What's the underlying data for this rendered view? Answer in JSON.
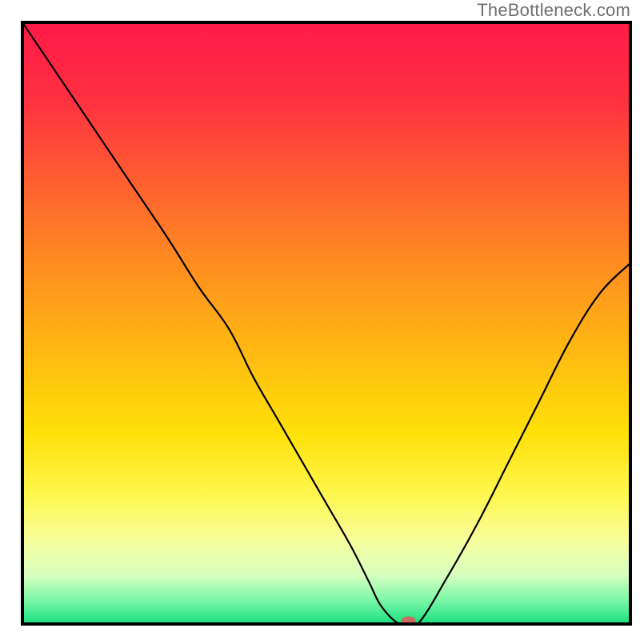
{
  "watermark": "TheBottleneck.com",
  "chart_data": {
    "type": "line",
    "title": "",
    "xlabel": "",
    "ylabel": "",
    "xlim": [
      0,
      100
    ],
    "ylim": [
      0,
      100
    ],
    "legend": false,
    "grid": false,
    "background_gradient": {
      "orientation": "vertical",
      "stops": [
        {
          "offset": 0.0,
          "color": "#ff1a49"
        },
        {
          "offset": 0.12,
          "color": "#ff2e42"
        },
        {
          "offset": 0.25,
          "color": "#ff5a32"
        },
        {
          "offset": 0.4,
          "color": "#ff8c20"
        },
        {
          "offset": 0.55,
          "color": "#ffba12"
        },
        {
          "offset": 0.68,
          "color": "#ffe008"
        },
        {
          "offset": 0.78,
          "color": "#fff64a"
        },
        {
          "offset": 0.86,
          "color": "#f8ff9c"
        },
        {
          "offset": 0.92,
          "color": "#d6ffc0"
        },
        {
          "offset": 0.96,
          "color": "#7cf7a8"
        },
        {
          "offset": 1.0,
          "color": "#18e07e"
        }
      ]
    },
    "series": [
      {
        "name": "bottleneck-curve",
        "stroke": "#000000",
        "stroke_width": 2.2,
        "x": [
          0,
          6,
          12,
          18,
          24,
          29,
          34,
          38,
          42,
          46,
          50,
          54,
          57,
          59,
          62,
          65,
          70,
          75,
          80,
          85,
          90,
          95,
          100
        ],
        "y": [
          100,
          91,
          82,
          73,
          64,
          56,
          49,
          41,
          34,
          27,
          20,
          13,
          7,
          3,
          0,
          0,
          8,
          17,
          27,
          37,
          47,
          55,
          60
        ]
      }
    ],
    "marker": {
      "name": "minimum-marker",
      "x": 63.5,
      "y": 0,
      "rx": 9,
      "ry": 6,
      "color": "#cd6a61"
    },
    "frame": {
      "stroke": "#000000",
      "stroke_width": 4
    }
  }
}
